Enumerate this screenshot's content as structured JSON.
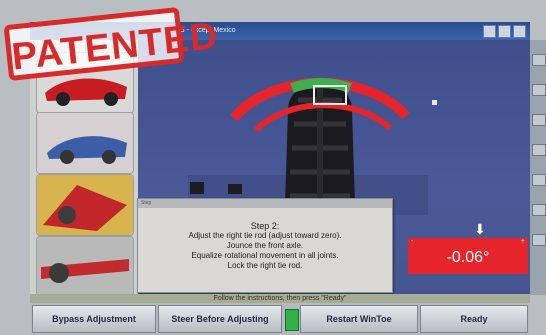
{
  "window": {
    "title": "S - except Mexico"
  },
  "stamp": {
    "text": "PATENTED"
  },
  "viewport": {
    "icons": [
      "tire-icon",
      "camber-arc-gauge-icon"
    ]
  },
  "dialog": {
    "title": "Step",
    "heading": "Step 2:",
    "lines": [
      "Adjust the right tie rod (adjust toward zero).",
      "Jounce the front axle.",
      "Equalize rotational movement in all joints.",
      "Lock the right tie rod."
    ]
  },
  "readout": {
    "value": "-0.06°",
    "minus": "-",
    "plus": "+"
  },
  "instruction_bar": {
    "text": "Follow the instructions, then press \"Ready\""
  },
  "buttons": {
    "bypass": "Bypass Adjustment",
    "steer": "Steer Before Adjusting",
    "restart": "Restart WinToe",
    "ready": "Ready"
  },
  "colors": {
    "accent_red": "#e6242b",
    "viewport_blue": "#45558f",
    "gauge_green": "#3fae4f"
  }
}
